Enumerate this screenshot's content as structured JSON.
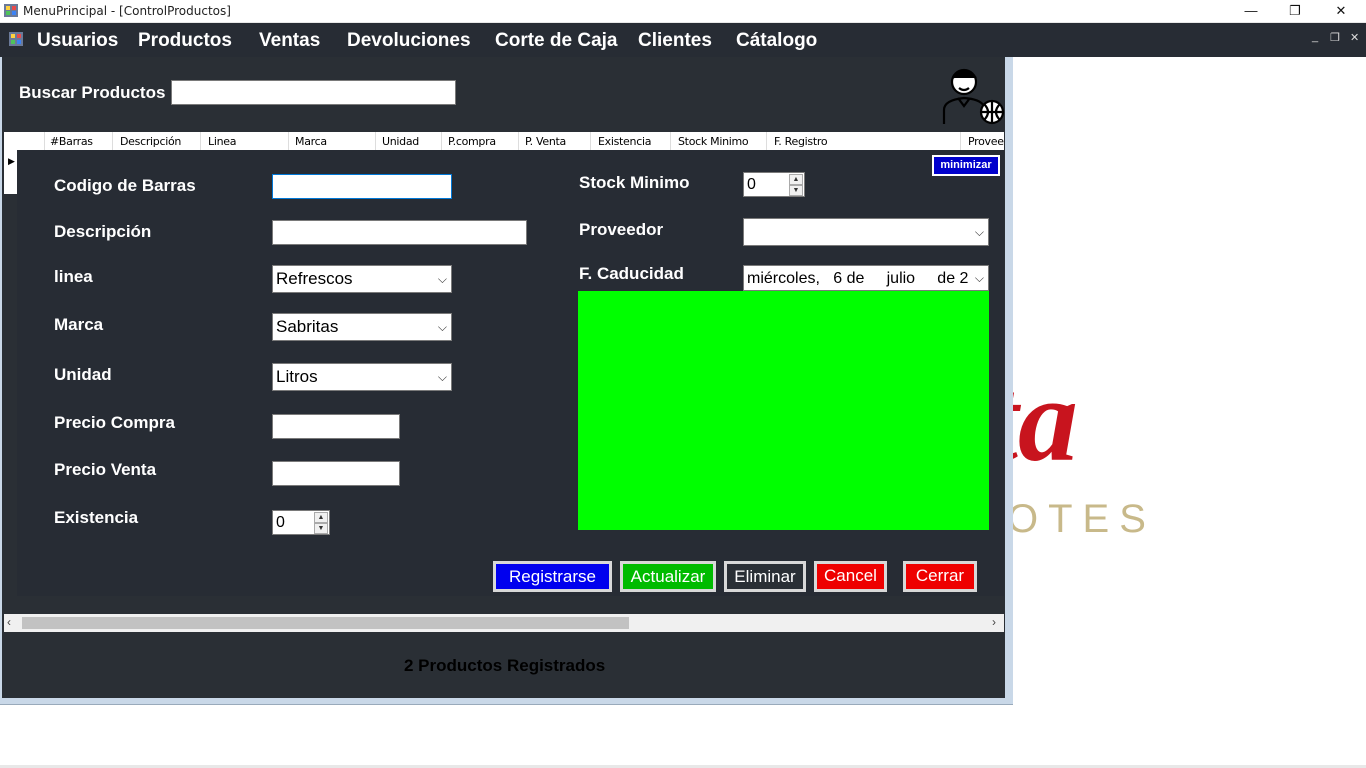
{
  "window": {
    "title": "MenuPrincipal - [ControlProductos]",
    "minimize": "—",
    "restore": "❐",
    "close": "✕"
  },
  "menu": {
    "items": [
      "Usuarios",
      "Productos",
      "Ventas",
      "Devoluciones",
      "Corte de Caja",
      "Clientes",
      "Cátalogo"
    ],
    "mdi_min": "_",
    "mdi_restore": "❐",
    "mdi_close": "✕"
  },
  "search": {
    "label": "Buscar Productos",
    "value": ""
  },
  "grid": {
    "columns": [
      "#Barras",
      "Descripción",
      "Linea",
      "Marca",
      "Unidad",
      "P.compra",
      "P. Venta",
      "Existencia",
      "Stock Minimo",
      "F. Registro",
      "Proveedor"
    ]
  },
  "form": {
    "minimize_label": "minimizar",
    "codigo_label": "Codigo de Barras",
    "codigo_value": "",
    "descripcion_label": "Descripción",
    "descripcion_value": "",
    "linea_label": "linea",
    "linea_value": "Refrescos",
    "marca_label": "Marca",
    "marca_value": "Sabritas",
    "unidad_label": "Unidad",
    "unidad_value": "Litros",
    "precio_compra_label": "Precio Compra",
    "precio_venta_label": "Precio Venta",
    "existencia_label": "Existencia",
    "existencia_value": "0",
    "stock_label": "Stock Minimo",
    "stock_value": "0",
    "proveedor_label": "Proveedor",
    "proveedor_value": "",
    "caducidad_label": "F. Caducidad",
    "caducidad_value": "miércoles,   6 de     julio     de 2"
  },
  "buttons": {
    "registrar": "Registrarse",
    "actualizar": "Actualizar",
    "eliminar": "Eliminar",
    "cancel": "Cancel",
    "cerrar": "Cerrar"
  },
  "status": {
    "text": "2 Productos Registrados"
  },
  "background_logo": {
    "text_main": "sta",
    "text_sub": "OTES"
  },
  "colors": {
    "menu_bg": "#272c34",
    "panel_bg": "#272c34",
    "image_placeholder": "#00ff00",
    "btn_registrar": "#0000ee",
    "btn_actualizar": "#00bb00",
    "btn_eliminar": "#2a2f35",
    "btn_cancel": "#ee0000",
    "logo_red": "#c8141e",
    "logo_gold": "#c8b98a"
  }
}
